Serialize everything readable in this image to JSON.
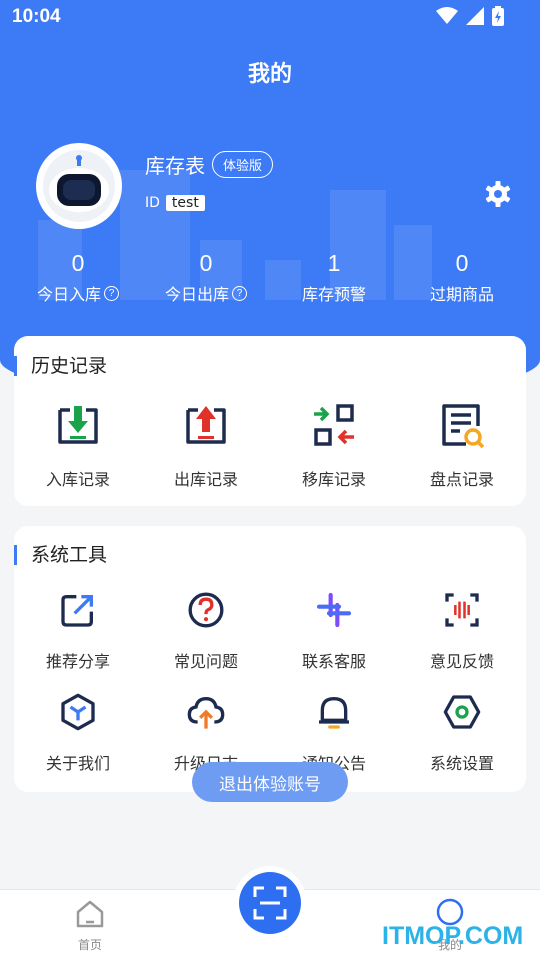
{
  "status_bar": {
    "time": "10:04"
  },
  "header": {
    "title": "我的"
  },
  "profile": {
    "name": "库存表",
    "badge": "体验版",
    "id_label": "ID",
    "id_value": "test"
  },
  "stats": [
    {
      "value": "0",
      "label": "今日入库",
      "help": "?"
    },
    {
      "value": "0",
      "label": "今日出库",
      "help": "?"
    },
    {
      "value": "1",
      "label": "库存预警"
    },
    {
      "value": "0",
      "label": "过期商品"
    }
  ],
  "history": {
    "title": "历史记录",
    "items": [
      {
        "label": "入库记录",
        "icon": "inbound-record-icon"
      },
      {
        "label": "出库记录",
        "icon": "outbound-record-icon"
      },
      {
        "label": "移库记录",
        "icon": "transfer-record-icon"
      },
      {
        "label": "盘点记录",
        "icon": "stocktake-record-icon"
      }
    ]
  },
  "tools": {
    "title": "系统工具",
    "items": [
      {
        "label": "推荐分享",
        "icon": "share-icon"
      },
      {
        "label": "常见问题",
        "icon": "question-icon"
      },
      {
        "label": "联系客服",
        "icon": "customer-service-icon"
      },
      {
        "label": "意见反馈",
        "icon": "feedback-icon"
      },
      {
        "label": "关于我们",
        "icon": "about-icon"
      },
      {
        "label": "升级日志",
        "icon": "upgrade-log-icon"
      },
      {
        "label": "通知公告",
        "icon": "bell-icon"
      },
      {
        "label": "系统设置",
        "icon": "settings-icon"
      }
    ]
  },
  "logout_label": "退出体验账号",
  "tabbar": {
    "home_label": "首页",
    "mine_label": "我的"
  },
  "watermark": "ITMOP.COM",
  "colors": {
    "primary": "#3d7af5",
    "accent_green": "#1aa34a",
    "accent_red": "#e0322a",
    "accent_orange": "#f5a623",
    "dark": "#1d2b4f"
  }
}
